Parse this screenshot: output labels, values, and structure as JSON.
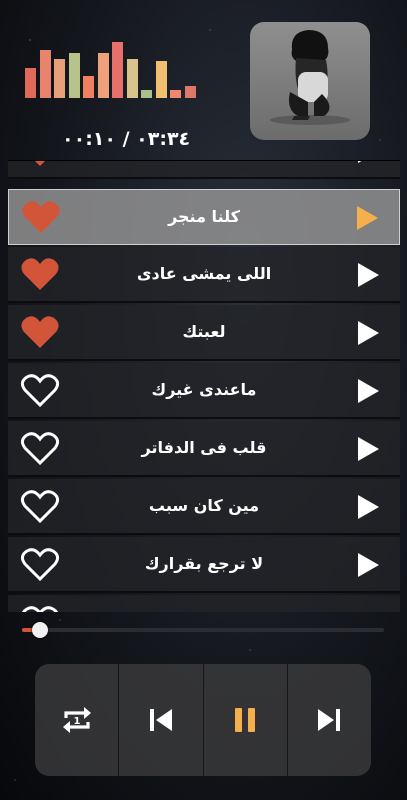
{
  "now_playing": {
    "elapsed_time": "٠٠:١٠",
    "separator": " / ",
    "total_time": "٠٣:٣٤",
    "progress_fraction": 0.05
  },
  "playlist": {
    "items": [
      {
        "title": "كلنا منجر",
        "favorite": true,
        "active": true
      },
      {
        "title": "اللى يمشى عادى",
        "favorite": true,
        "active": false
      },
      {
        "title": "لعبتك",
        "favorite": true,
        "active": false
      },
      {
        "title": "ماعندى غيرك",
        "favorite": false,
        "active": false
      },
      {
        "title": "قلب فى الدفاتر",
        "favorite": false,
        "active": false
      },
      {
        "title": "مين كان سبب",
        "favorite": false,
        "active": false
      },
      {
        "title": "لا ترجع بقرارك",
        "favorite": false,
        "active": false
      }
    ]
  },
  "controls": {
    "repeat_icon": "repeat-one-icon",
    "previous_icon": "skip-previous-icon",
    "play_pause_icon": "pause-icon",
    "next_icon": "skip-next-icon"
  },
  "colors": {
    "heart_fill": "#d2553a",
    "active_play_icon": "#f4b04a",
    "pause_icon": "#f4b04a",
    "equalizer": [
      "#e06a5a",
      "#e8836e",
      "#e9a07a",
      "#b7c38a",
      "#ef8060",
      "#f0a07a",
      "#e7706a",
      "#d8c48a",
      "#a8c08c",
      "#f0c070",
      "#f08870",
      "#e0786a"
    ]
  },
  "equalizer_levels": [
    0.52,
    0.82,
    0.68,
    0.78,
    0.38,
    0.78,
    0.97,
    0.68,
    0.14,
    0.63,
    0.13,
    0.2
  ]
}
